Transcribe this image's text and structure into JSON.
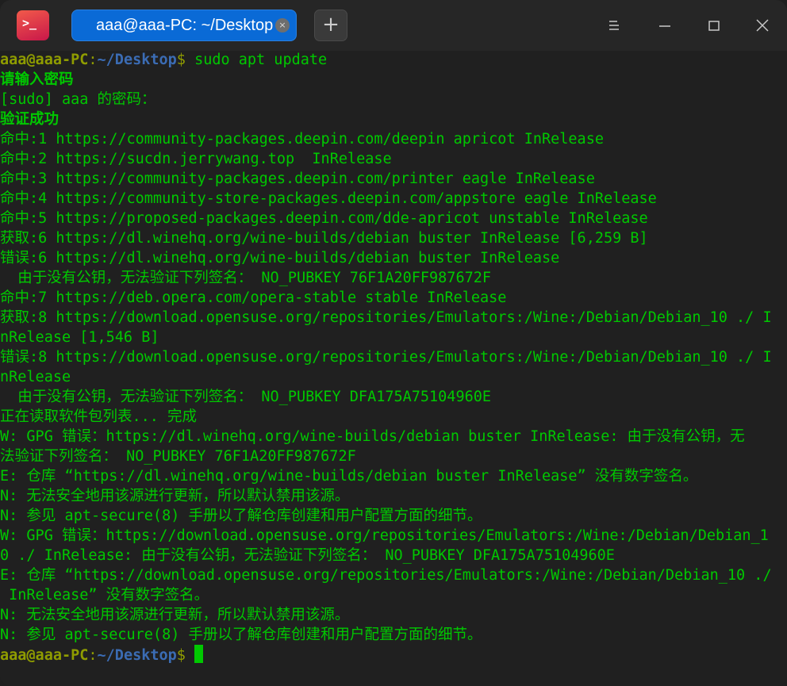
{
  "window": {
    "app_icon": "terminal-icon",
    "app_icon_glyph": ">_",
    "tab_title": "aaa@aaa-PC: ~/Desktop",
    "tab_close": "×",
    "new_tab": "+",
    "controls": [
      "menu-icon",
      "minimize-icon",
      "maximize-icon",
      "close-icon"
    ]
  },
  "colors": {
    "text_green": "#00c800",
    "user": "#8f9c00",
    "path": "#3b6cb4",
    "tab": "#0a6ad6",
    "background": "#202020"
  },
  "prompt": {
    "user": "aaa@aaa-PC",
    "colon": ":",
    "path": "~/Desktop",
    "dollar": "$ "
  },
  "lines": [
    {
      "prompt": true,
      "text": "sudo apt update"
    },
    {
      "bold": true,
      "text": "请输入密码"
    },
    {
      "text": "[sudo] aaa 的密码："
    },
    {
      "bold": true,
      "text": "验证成功"
    },
    {
      "text": "命中:1 https://community-packages.deepin.com/deepin apricot InRelease"
    },
    {
      "text": "命中:2 https://sucdn.jerrywang.top  InRelease"
    },
    {
      "text": "命中:3 https://community-packages.deepin.com/printer eagle InRelease"
    },
    {
      "text": "命中:4 https://community-store-packages.deepin.com/appstore eagle InRelease"
    },
    {
      "text": "命中:5 https://proposed-packages.deepin.com/dde-apricot unstable InRelease"
    },
    {
      "text": "获取:6 https://dl.winehq.org/wine-builds/debian buster InRelease [6,259 B]"
    },
    {
      "text": "错误:6 https://dl.winehq.org/wine-builds/debian buster InRelease"
    },
    {
      "text": "  由于没有公钥，无法验证下列签名： NO_PUBKEY 76F1A20FF987672F"
    },
    {
      "text": "命中:7 https://deb.opera.com/opera-stable stable InRelease"
    },
    {
      "text": "获取:8 https://download.opensuse.org/repositories/Emulators:/Wine:/Debian/Debian_10 ./ I"
    },
    {
      "text": "nRelease [1,546 B]"
    },
    {
      "text": "错误:8 https://download.opensuse.org/repositories/Emulators:/Wine:/Debian/Debian_10 ./ I"
    },
    {
      "text": "nRelease"
    },
    {
      "text": "  由于没有公钥，无法验证下列签名： NO_PUBKEY DFA175A75104960E"
    },
    {
      "text": "正在读取软件包列表... 完成"
    },
    {
      "text": "W: GPG 错误：https://dl.winehq.org/wine-builds/debian buster InRelease: 由于没有公钥，无"
    },
    {
      "text": "法验证下列签名： NO_PUBKEY 76F1A20FF987672F"
    },
    {
      "text": "E: 仓库 “https://dl.winehq.org/wine-builds/debian buster InRelease” 没有数字签名。"
    },
    {
      "text": "N: 无法安全地用该源进行更新，所以默认禁用该源。"
    },
    {
      "text": "N: 参见 apt-secure(8) 手册以了解仓库创建和用户配置方面的细节。"
    },
    {
      "text": "W: GPG 错误：https://download.opensuse.org/repositories/Emulators:/Wine:/Debian/Debian_1"
    },
    {
      "text": "0 ./ InRelease: 由于没有公钥，无法验证下列签名： NO_PUBKEY DFA175A75104960E"
    },
    {
      "text": "E: 仓库 “https://download.opensuse.org/repositories/Emulators:/Wine:/Debian/Debian_10 ./"
    },
    {
      "text": " InRelease” 没有数字签名。"
    },
    {
      "text": "N: 无法安全地用该源进行更新，所以默认禁用该源。"
    },
    {
      "text": "N: 参见 apt-secure(8) 手册以了解仓库创建和用户配置方面的细节。"
    },
    {
      "prompt": true,
      "text": "",
      "cursor": true
    }
  ]
}
